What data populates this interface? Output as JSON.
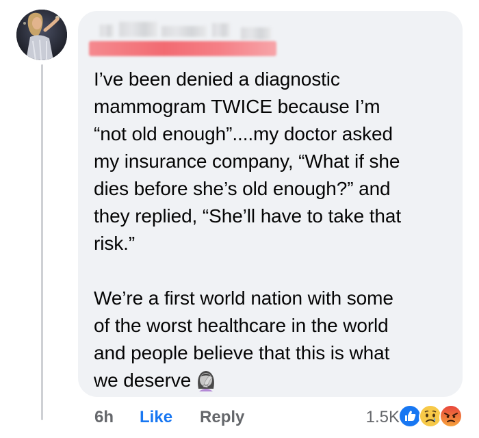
{
  "comment": {
    "paragraphs": [
      "I’ve been denied a diagnostic\nmammogram TWICE because I’m\n“not old enough”....my doctor asked\nmy insurance company, “What if she\ndies before she’s old enough?” and\nthey replied, “She’ll have to take that\nrisk.”",
      "We’re a first world nation with some\nof the worst healthcare in the world\nand people believe that this is what\nwe deserve"
    ],
    "emoji_icon": "woman-facepalming-icon"
  },
  "author": {
    "avatar_icon": "user-avatar-photo",
    "name_redacted": true
  },
  "actions": {
    "time": "6h",
    "like_label": "Like",
    "reply_label": "Reply"
  },
  "reactions": {
    "count": "1.5K",
    "icons": [
      "like-reaction-icon",
      "sad-reaction-icon",
      "angry-reaction-icon"
    ]
  },
  "colors": {
    "bubble": "#f0f2f5",
    "link_blue": "#1877f2",
    "meta_grey": "#65676b",
    "redaction_red": "#f26b72"
  }
}
